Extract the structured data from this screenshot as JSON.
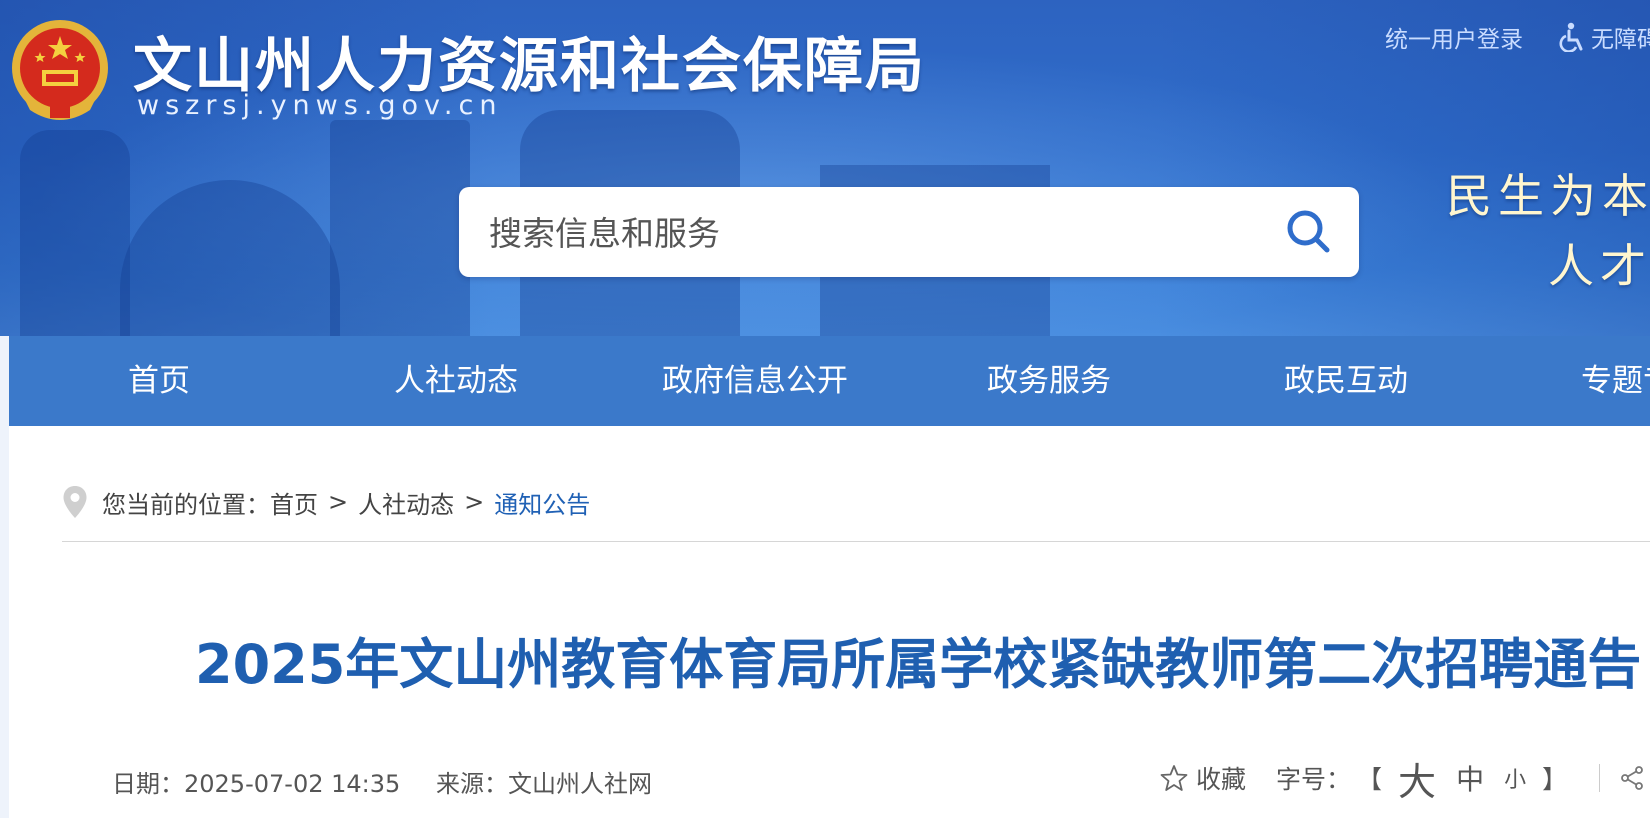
{
  "header": {
    "site_title": "文山州人力资源和社会保障局",
    "site_domain": "wszrsj.ynws.gov.cn",
    "login_link": "统一用户登录",
    "accessibility_link": "无障碍",
    "slogan_line1": "民生为本",
    "slogan_line2": "人才优先"
  },
  "search": {
    "placeholder": "搜索信息和服务"
  },
  "nav": {
    "items": [
      "首页",
      "人社动态",
      "政府信息公开",
      "政务服务",
      "政民互动",
      "专题专栏"
    ]
  },
  "breadcrumb": {
    "prefix": "您当前的位置：",
    "items": [
      "首页",
      "人社动态",
      "通知公告"
    ],
    "separator": ">"
  },
  "article": {
    "title": "2025年文山州教育体育局所属学校紧缺教师第二次招聘通告",
    "date_label": "日期：",
    "date": "2025-07-02 14:35",
    "source_label": "来源：",
    "source": "文山州人社网"
  },
  "toolbar": {
    "favorite_label": "收藏",
    "font_size_label": "字号：",
    "bracket_open": "【",
    "bracket_close": "】",
    "size_large": "大",
    "size_medium": "中",
    "size_small": "小"
  },
  "colors": {
    "banner": "#2f6dcb",
    "nav": "#3b79ca",
    "title": "#1f5fb0",
    "link_current": "#2061b5",
    "wechat": "#2dab3c"
  }
}
